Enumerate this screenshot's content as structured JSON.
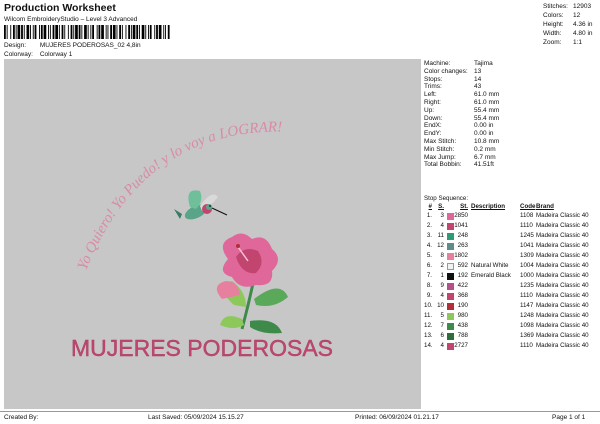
{
  "header": {
    "title": "Production Worksheet",
    "subtitle": "Wilcom EmbroideryStudio – Level 3 Advanced",
    "design_label": "Design:",
    "design_value": "MUJERES PODEROSAS_02 4,8in",
    "colorway_label": "Colorway:",
    "colorway_value": "Colorway 1"
  },
  "stats": [
    {
      "label": "Stitches:",
      "value": "12903"
    },
    {
      "label": "Colors:",
      "value": "12"
    },
    {
      "label": "Height:",
      "value": "4.36 in"
    },
    {
      "label": "Width:",
      "value": "4.80 in"
    },
    {
      "label": "Zoom:",
      "value": "1:1"
    }
  ],
  "artwork": {
    "arc_text": "Yo Quiero! Yo Puedo! y lo voy a LOGRAR!",
    "bottom_text": "MUJERES PODEROSAS"
  },
  "info": [
    {
      "label": "Machine:",
      "value": "Tajima"
    },
    {
      "label": "Color changes:",
      "value": "13"
    },
    {
      "label": "Stops:",
      "value": "14"
    },
    {
      "label": "Trims:",
      "value": "43"
    },
    {
      "label": "Left:",
      "value": "61.0 mm"
    },
    {
      "label": "Right:",
      "value": "61.0 mm"
    },
    {
      "label": "Up:",
      "value": "55.4 mm"
    },
    {
      "label": "Down:",
      "value": "55.4 mm"
    },
    {
      "label": "EndX:",
      "value": "0.00 in"
    },
    {
      "label": "EndY:",
      "value": "0.00 in"
    },
    {
      "label": "Max Stitch:",
      "value": "10.8 mm"
    },
    {
      "label": "Min Stitch:",
      "value": "0.2 mm"
    },
    {
      "label": "Max Jump:",
      "value": "6.7 mm"
    },
    {
      "label": "Total Bobbin:",
      "value": "41.51ft"
    }
  ],
  "stop_sequence": {
    "title": "Stop Sequence:",
    "headers": {
      "n": "#",
      "s": "S.",
      "st": "St.",
      "desc": "Description",
      "code": "Code",
      "brand": "Brand"
    },
    "rows": [
      {
        "n": "1.",
        "s": "3",
        "color": "#e0679a",
        "st": "2850",
        "desc": "",
        "code": "1108",
        "brand": "Madeira Classic 40"
      },
      {
        "n": "2.",
        "s": "4",
        "color": "#c2456f",
        "st": "1041",
        "desc": "",
        "code": "1110",
        "brand": "Madeira Classic 40"
      },
      {
        "n": "3.",
        "s": "11",
        "color": "#2f9a78",
        "st": "248",
        "desc": "",
        "code": "1245",
        "brand": "Madeira Classic 40"
      },
      {
        "n": "4.",
        "s": "12",
        "color": "#5e8c8a",
        "st": "263",
        "desc": "",
        "code": "1041",
        "brand": "Madeira Classic 40"
      },
      {
        "n": "5.",
        "s": "8",
        "color": "#e6809e",
        "st": "1802",
        "desc": "",
        "code": "1309",
        "brand": "Madeira Classic 40"
      },
      {
        "n": "6.",
        "s": "2",
        "color": "#f2f2f2",
        "st": "592",
        "desc": "Natural White",
        "code": "1004",
        "brand": "Madeira Classic 40"
      },
      {
        "n": "7.",
        "s": "1",
        "color": "#101010",
        "st": "192",
        "desc": "Emerald Black",
        "code": "1000",
        "brand": "Madeira Classic 40"
      },
      {
        "n": "8.",
        "s": "9",
        "color": "#b4508a",
        "st": "422",
        "desc": "",
        "code": "1235",
        "brand": "Madeira Classic 40"
      },
      {
        "n": "9.",
        "s": "4",
        "color": "#c2456f",
        "st": "368",
        "desc": "",
        "code": "1110",
        "brand": "Madeira Classic 40"
      },
      {
        "n": "10.",
        "s": "10",
        "color": "#b22e3a",
        "st": "190",
        "desc": "",
        "code": "1147",
        "brand": "Madeira Classic 40"
      },
      {
        "n": "11.",
        "s": "5",
        "color": "#8cc85a",
        "st": "980",
        "desc": "",
        "code": "1248",
        "brand": "Madeira Classic 40"
      },
      {
        "n": "12.",
        "s": "7",
        "color": "#3d8a4a",
        "st": "438",
        "desc": "",
        "code": "1098",
        "brand": "Madeira Classic 40"
      },
      {
        "n": "13.",
        "s": "6",
        "color": "#2f6e3a",
        "st": "788",
        "desc": "",
        "code": "1369",
        "brand": "Madeira Classic 40"
      },
      {
        "n": "14.",
        "s": "4",
        "color": "#c2456f",
        "st": "2727",
        "desc": "",
        "code": "1110",
        "brand": "Madeira Classic 40"
      }
    ]
  },
  "footer": {
    "created_by": "Created By:",
    "last_saved": "Last Saved: 05/09/2024 15.15.27",
    "printed": "Printed: 06/09/2024 01.21.17",
    "page": "Page 1 of 1"
  },
  "colors": {
    "canvas_bg": "#c7c7c7",
    "text_pink": "#d98aa8",
    "text_dark_pink": "#a3405f",
    "title_pink": "#c2456f"
  }
}
